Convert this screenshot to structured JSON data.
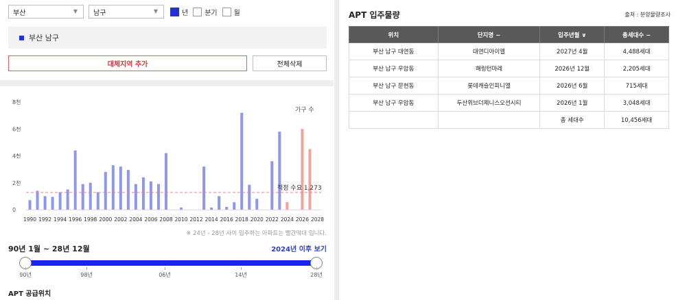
{
  "filters": {
    "city": "부산",
    "district": "남구",
    "periods": [
      {
        "label": "년",
        "checked": true
      },
      {
        "label": "분기",
        "checked": false
      },
      {
        "label": "월",
        "checked": false
      }
    ]
  },
  "selected_region": "부산 남구",
  "buttons": {
    "add_region": "대체지역 추가",
    "delete_all": "전체삭제"
  },
  "chart_data": {
    "type": "bar",
    "legend": "가구 수",
    "y_ticks": [
      "0",
      "2천",
      "4천",
      "6천",
      "8천"
    ],
    "ylim": [
      0,
      8000
    ],
    "x_tick_labels": [
      "1990",
      "1992",
      "1994",
      "1996",
      "1998",
      "2000",
      "2002",
      "2004",
      "2006",
      "2008",
      "2010",
      "2012",
      "2014",
      "2016",
      "2018",
      "2020",
      "2022",
      "2024",
      "2026",
      "2028"
    ],
    "years": [
      1990,
      1991,
      1992,
      1993,
      1994,
      1995,
      1996,
      1997,
      1998,
      1999,
      2000,
      2001,
      2002,
      2003,
      2004,
      2005,
      2006,
      2007,
      2008,
      2009,
      2010,
      2011,
      2012,
      2013,
      2014,
      2015,
      2016,
      2017,
      2018,
      2019,
      2020,
      2021,
      2022,
      2023,
      2024,
      2025,
      2026,
      2027
    ],
    "values": [
      700,
      1400,
      1000,
      950,
      1300,
      1500,
      4400,
      1900,
      2000,
      1300,
      2800,
      3300,
      3200,
      2950,
      1900,
      2400,
      2100,
      1900,
      4200,
      0,
      150,
      0,
      0,
      3200,
      150,
      1000,
      200,
      550,
      7200,
      1850,
      800,
      0,
      3600,
      5800,
      550,
      0,
      6000,
      4500
    ],
    "highlight_from": 2024,
    "colors": {
      "normal": "#8d97f0",
      "highlight": "#f3a29a",
      "reference": "#f07f7f"
    },
    "reference_line": {
      "value": 1273,
      "label": "적정 수요 1,273"
    }
  },
  "chart_note": "※ 24년 - 28년 사이 입주하는 아파트는 빨간막대 입니다.",
  "range": {
    "title": "90년 1월 ~ 28년 12월",
    "link": "2024년 이후 보기",
    "start": 0,
    "end": 1,
    "ticks": [
      "90년",
      "98년",
      "06년",
      "14년",
      "28년"
    ],
    "track_color": "#1a22ef"
  },
  "supply_section_title": "APT 공급위치",
  "move_in": {
    "title": "APT 입주물량",
    "source": "출처 : 분양물량조사",
    "headers": [
      "위치",
      "단지명 −",
      "입주년월 ∨",
      "총세대수 −"
    ],
    "rows": [
      [
        "부산 남구 대연동",
        "대연디아이엘",
        "2027년 4월",
        "4,488세대"
      ],
      [
        "부산 남구 우암동",
        "해링턴마레",
        "2026년 12월",
        "2,205세대"
      ],
      [
        "부산 남구 문현동",
        "롯데캐슬인피니엘",
        "2026년 6월",
        "715세대"
      ],
      [
        "부산 남구 우암동",
        "두산위브더제니스오션시티",
        "2026년 1월",
        "3,048세대"
      ]
    ],
    "total_label": "총 세대수",
    "total_value": "10,456세대"
  }
}
